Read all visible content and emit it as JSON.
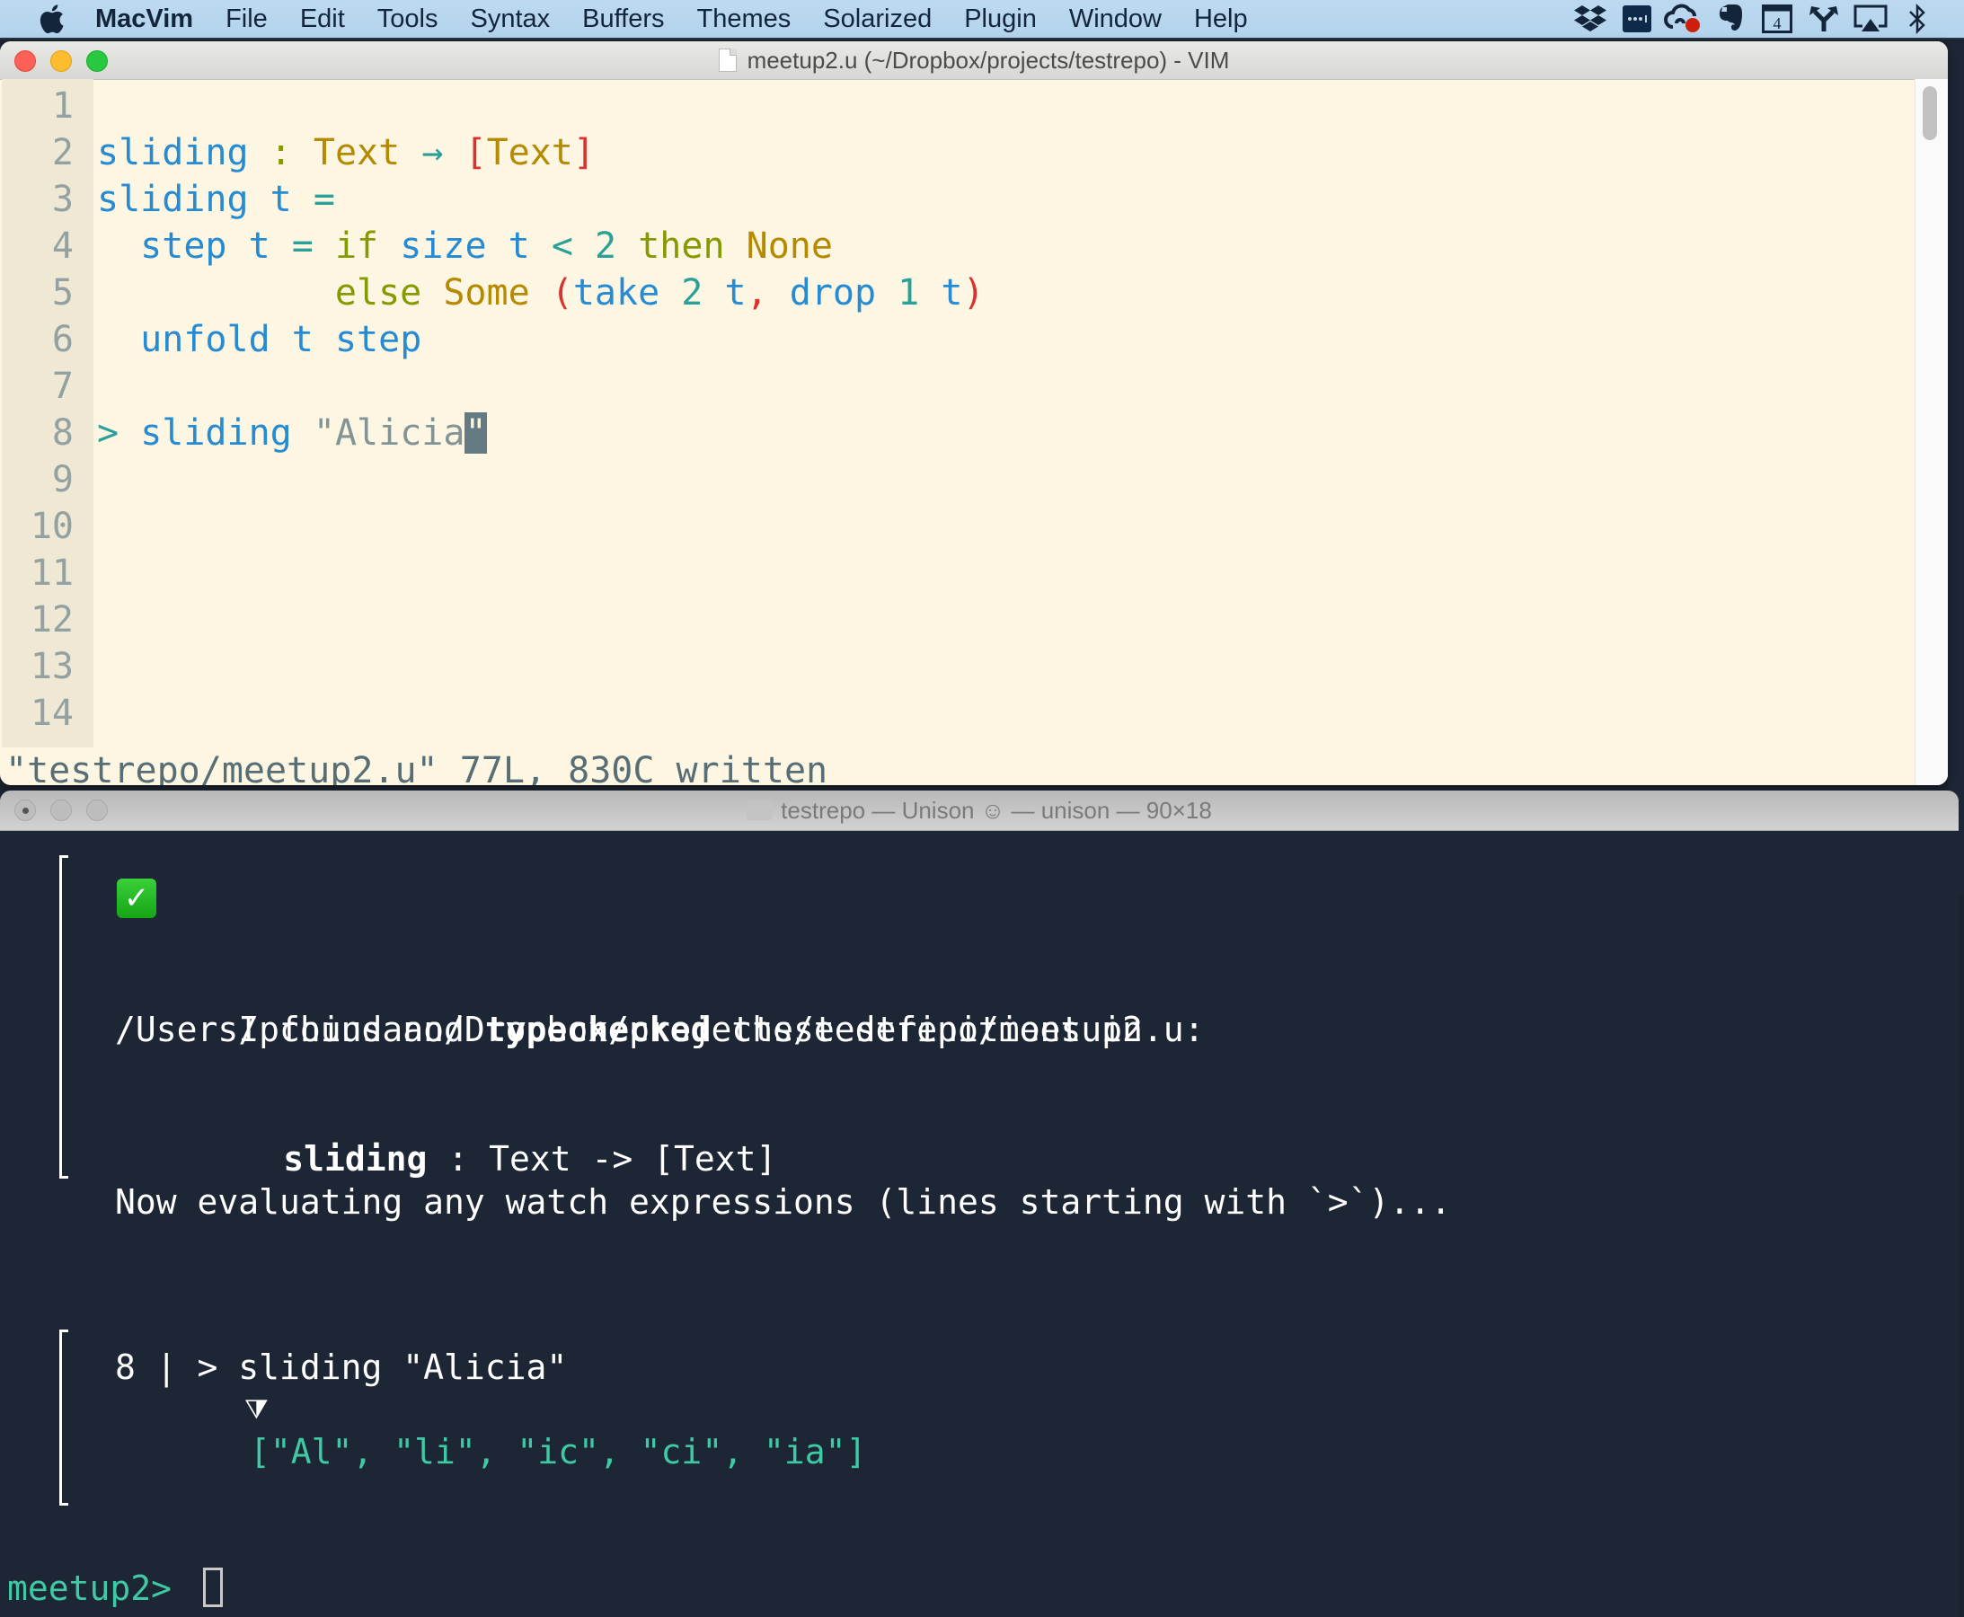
{
  "menubar": {
    "apple_icon": "apple-logo",
    "items": [
      "MacVim",
      "File",
      "Edit",
      "Tools",
      "Syntax",
      "Buffers",
      "Themes",
      "Solarized",
      "Plugin",
      "Window",
      "Help"
    ],
    "status_icons": [
      "dropbox-icon",
      "1password-icon",
      "creative-cloud-icon",
      "evernote-icon",
      "calendar-icon",
      "fork-icon",
      "airplay-icon",
      "bluetooth-icon"
    ],
    "calendar_day": "4"
  },
  "vim": {
    "title": "meetup2.u (~/Dropbox/projects/testrepo) - VIM",
    "lines": [
      {
        "num": "1",
        "tokens": []
      },
      {
        "num": "2",
        "tokens": [
          {
            "t": "sliding",
            "c": "fn"
          },
          {
            "t": " ",
            "c": "plain"
          },
          {
            "t": ":",
            "c": "kw"
          },
          {
            "t": " ",
            "c": "plain"
          },
          {
            "t": "Text",
            "c": "type"
          },
          {
            "t": " ",
            "c": "plain"
          },
          {
            "t": "→",
            "c": "op"
          },
          {
            "t": " ",
            "c": "plain"
          },
          {
            "t": "[",
            "c": "brk"
          },
          {
            "t": "Text",
            "c": "type"
          },
          {
            "t": "]",
            "c": "brk"
          }
        ]
      },
      {
        "num": "3",
        "tokens": [
          {
            "t": "sliding",
            "c": "fn"
          },
          {
            "t": " ",
            "c": "plain"
          },
          {
            "t": "t",
            "c": "fn"
          },
          {
            "t": " ",
            "c": "plain"
          },
          {
            "t": "=",
            "c": "op"
          }
        ]
      },
      {
        "num": "4",
        "tokens": [
          {
            "t": "  ",
            "c": "plain"
          },
          {
            "t": "step",
            "c": "fn"
          },
          {
            "t": " ",
            "c": "plain"
          },
          {
            "t": "t",
            "c": "fn"
          },
          {
            "t": " ",
            "c": "plain"
          },
          {
            "t": "=",
            "c": "op"
          },
          {
            "t": " ",
            "c": "plain"
          },
          {
            "t": "if",
            "c": "kw"
          },
          {
            "t": " ",
            "c": "plain"
          },
          {
            "t": "size",
            "c": "fn"
          },
          {
            "t": " ",
            "c": "plain"
          },
          {
            "t": "t",
            "c": "fn"
          },
          {
            "t": " ",
            "c": "plain"
          },
          {
            "t": "<",
            "c": "op"
          },
          {
            "t": " ",
            "c": "plain"
          },
          {
            "t": "2",
            "c": "num"
          },
          {
            "t": " ",
            "c": "plain"
          },
          {
            "t": "then",
            "c": "kw"
          },
          {
            "t": " ",
            "c": "plain"
          },
          {
            "t": "None",
            "c": "type"
          }
        ]
      },
      {
        "num": "5",
        "tokens": [
          {
            "t": "           ",
            "c": "plain"
          },
          {
            "t": "else",
            "c": "kw"
          },
          {
            "t": " ",
            "c": "plain"
          },
          {
            "t": "Some",
            "c": "type"
          },
          {
            "t": " ",
            "c": "plain"
          },
          {
            "t": "(",
            "c": "brk"
          },
          {
            "t": "take",
            "c": "fn"
          },
          {
            "t": " ",
            "c": "plain"
          },
          {
            "t": "2",
            "c": "num"
          },
          {
            "t": " ",
            "c": "plain"
          },
          {
            "t": "t",
            "c": "fn"
          },
          {
            "t": ",",
            "c": "brk"
          },
          {
            "t": " ",
            "c": "plain"
          },
          {
            "t": "drop",
            "c": "fn"
          },
          {
            "t": " ",
            "c": "plain"
          },
          {
            "t": "1",
            "c": "num"
          },
          {
            "t": " ",
            "c": "plain"
          },
          {
            "t": "t",
            "c": "fn"
          },
          {
            "t": ")",
            "c": "brk"
          }
        ]
      },
      {
        "num": "6",
        "tokens": [
          {
            "t": "  ",
            "c": "plain"
          },
          {
            "t": "unfold",
            "c": "fn"
          },
          {
            "t": " ",
            "c": "plain"
          },
          {
            "t": "t",
            "c": "fn"
          },
          {
            "t": " ",
            "c": "plain"
          },
          {
            "t": "step",
            "c": "fn"
          }
        ]
      },
      {
        "num": "7",
        "tokens": []
      },
      {
        "num": "8",
        "tokens": [
          {
            "t": ">",
            "c": "op"
          },
          {
            "t": " ",
            "c": "plain"
          },
          {
            "t": "sliding",
            "c": "fn"
          },
          {
            "t": " ",
            "c": "plain"
          },
          {
            "t": "\"Alicia",
            "c": "str"
          },
          {
            "t": "\"",
            "c": "cursor"
          }
        ]
      },
      {
        "num": "9",
        "tokens": []
      },
      {
        "num": "10",
        "tokens": []
      },
      {
        "num": "11",
        "tokens": []
      },
      {
        "num": "12",
        "tokens": []
      },
      {
        "num": "13",
        "tokens": []
      },
      {
        "num": "14",
        "tokens": []
      }
    ],
    "status_message": "\"testrepo/meetup2.u\" 77L, 830C written"
  },
  "terminal": {
    "title": "testrepo — Unison ☺ — unison — 90×18",
    "check_emoji": "✓",
    "found_prefix": "I found and ",
    "found_bold": "typechecked",
    "found_suffix": " these definitions in",
    "path": "/Users/pchiusano/Dropbox/projects/testrepo/meetup2.u:",
    "def_name": "sliding",
    "def_sig": " : Text -> [Text]",
    "evaluating": "Now evaluating any watch expressions (lines starting with `>`)...",
    "watch_line": "8 | > sliding \"Alicia\"",
    "watch_arrow": "⧩",
    "watch_result": "[\"Al\", \"li\", \"ic\", \"ci\", \"ia\"]",
    "prompt": "meetup2>",
    "input_value": ""
  }
}
